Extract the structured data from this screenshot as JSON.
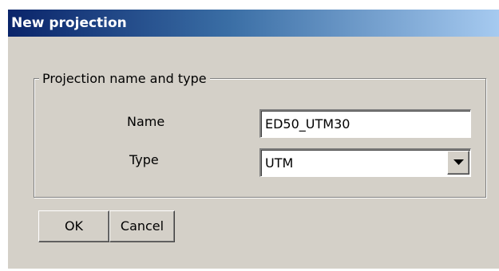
{
  "window": {
    "title": "New projection"
  },
  "group": {
    "legend": "Projection name and type"
  },
  "fields": {
    "name": {
      "label": "Name",
      "value": "ED50_UTM30"
    },
    "type": {
      "label": "Type",
      "selected": "UTM",
      "arrow_icon": "chevron-down-icon"
    }
  },
  "buttons": {
    "ok_label": "OK",
    "cancel_label": "Cancel"
  },
  "colors": {
    "dialog_face": "#d4d0c8",
    "titlebar_start": "#0a246a",
    "titlebar_end": "#a6caf0",
    "title_text": "#ffffff"
  }
}
